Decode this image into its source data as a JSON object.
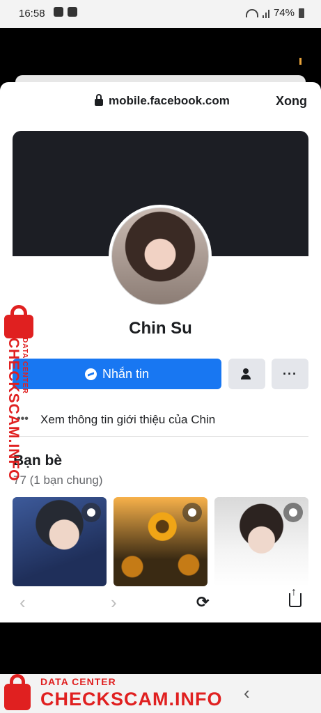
{
  "status_bar": {
    "time": "16:58",
    "battery": "74%"
  },
  "browser": {
    "url": "mobile.facebook.com",
    "done_label": "Xong"
  },
  "profile": {
    "name": "Chin Su",
    "message_label": "Nhắn tin",
    "more_label": "···",
    "about_link": "Xem thông tin giới thiệu của Chin"
  },
  "friends": {
    "title": "Bạn bè",
    "count": "77 (1 bạn chung)"
  },
  "navigation": {
    "back": "‹",
    "forward": "›",
    "refresh": "⟳",
    "android_back": "‹"
  },
  "watermark": {
    "top_text": "DATA CENTER",
    "brand_text": "CHECKSCAM.INFO"
  }
}
